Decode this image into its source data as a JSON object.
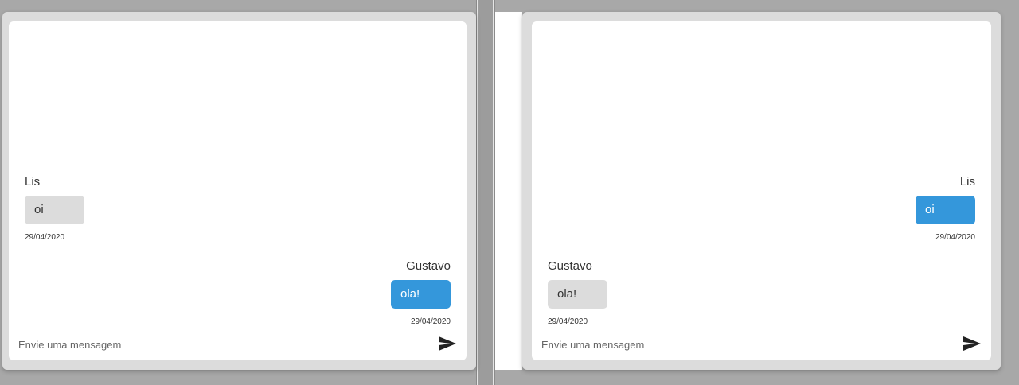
{
  "left_chat": {
    "messages": [
      {
        "author": "Lis",
        "text": "oi",
        "date": "29/04/2020",
        "side": "them"
      },
      {
        "author": "Gustavo",
        "text": "ola!",
        "date": "29/04/2020",
        "side": "me"
      }
    ],
    "input_placeholder": "Envie uma mensagem"
  },
  "right_chat": {
    "messages": [
      {
        "author": "Lis",
        "text": "oi",
        "date": "29/04/2020",
        "side": "me"
      },
      {
        "author": "Gustavo",
        "text": "ola!",
        "date": "29/04/2020",
        "side": "them"
      }
    ],
    "input_placeholder": "Envie uma mensagem"
  },
  "icons": {
    "send": "send-icon"
  },
  "colors": {
    "outgoing_bubble": "#3497db",
    "incoming_bubble": "#dcdcdc",
    "frame": "#dcdcdc",
    "background": "#a8a8a8"
  }
}
